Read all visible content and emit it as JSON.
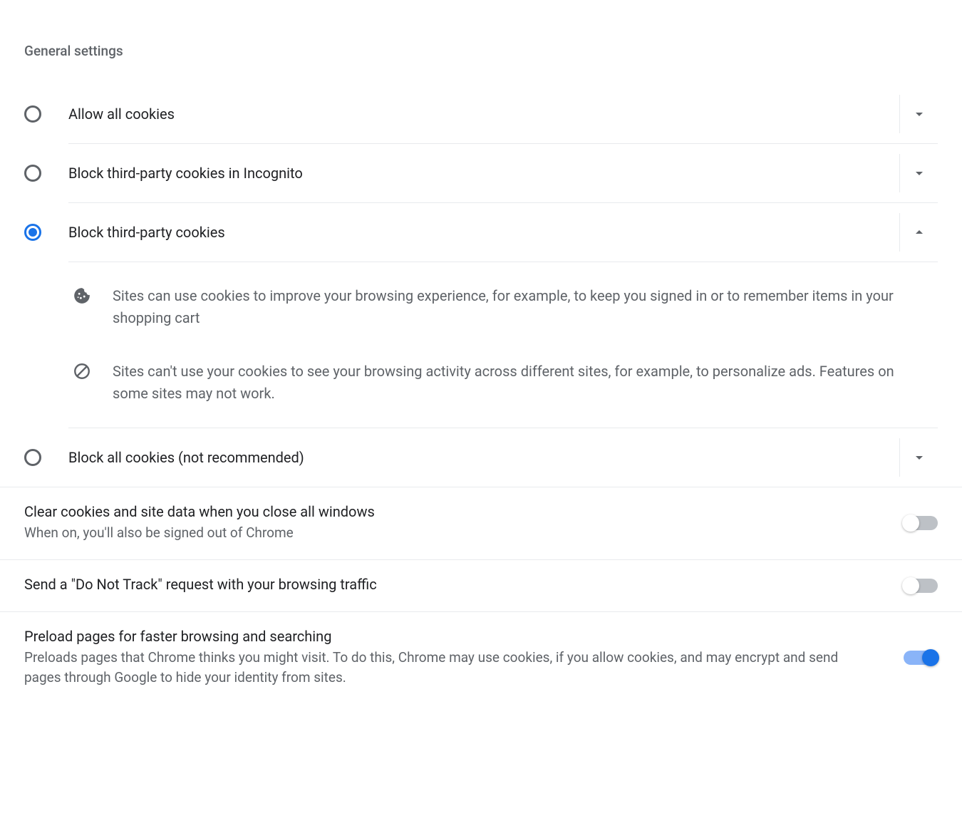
{
  "section_header": "General settings",
  "radios": [
    {
      "label": "Allow all cookies",
      "selected": false,
      "expanded": false
    },
    {
      "label": "Block third-party cookies in Incognito",
      "selected": false,
      "expanded": false
    },
    {
      "label": "Block third-party cookies",
      "selected": true,
      "expanded": true
    },
    {
      "label": "Block all cookies (not recommended)",
      "selected": false,
      "expanded": false
    }
  ],
  "details": [
    "Sites can use cookies to improve your browsing experience, for example, to keep you signed in or to remember items in your shopping cart",
    "Sites can't use your cookies to see your browsing activity across different sites, for example, to personalize ads. Features on some sites may not work."
  ],
  "toggles": [
    {
      "title": "Clear cookies and site data when you close all windows",
      "subtitle": "When on, you'll also be signed out of Chrome",
      "on": false
    },
    {
      "title": "Send a \"Do Not Track\" request with your browsing traffic",
      "subtitle": "",
      "on": false
    },
    {
      "title": "Preload pages for faster browsing and searching",
      "subtitle": "Preloads pages that Chrome thinks you might visit. To do this, Chrome may use cookies, if you allow cookies, and may encrypt and send pages through Google to hide your identity from sites.",
      "on": true
    }
  ]
}
